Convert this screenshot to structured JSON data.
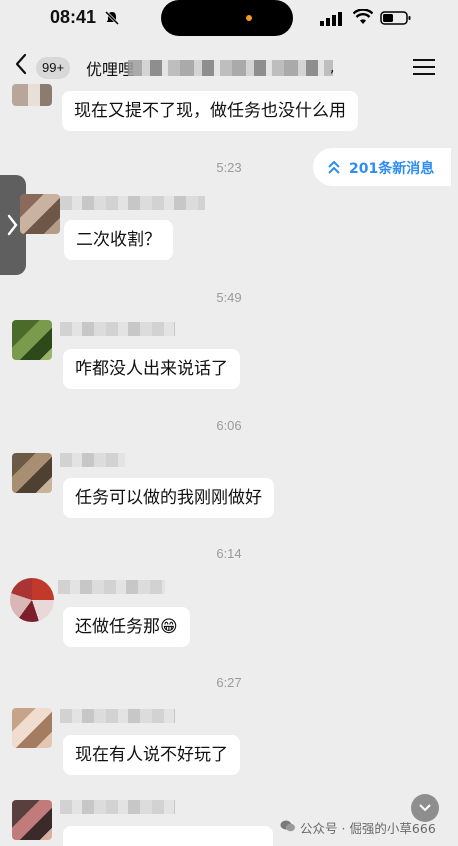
{
  "status_bar": {
    "time": "08:41"
  },
  "header": {
    "unread_count": "99+",
    "title_visible": "优哩哩",
    "title_tail": ","
  },
  "new_messages_pill": {
    "label": "201条新消息"
  },
  "timeline": [
    {
      "type": "message",
      "text": "现在又提不了现，做任务也没什么用"
    },
    {
      "type": "time",
      "text": "5:23"
    },
    {
      "type": "message",
      "text": "二次收割？"
    },
    {
      "type": "time",
      "text": "5:49"
    },
    {
      "type": "message",
      "text": "咋都没人出来说话了"
    },
    {
      "type": "time",
      "text": "6:06"
    },
    {
      "type": "message",
      "text": "任务可以做的我刚刚做好"
    },
    {
      "type": "time",
      "text": "6:14"
    },
    {
      "type": "message",
      "text": "还做任务那😁"
    },
    {
      "type": "time",
      "text": "6:27"
    },
    {
      "type": "message",
      "text": "现在有人说不好玩了"
    }
  ],
  "watermark": {
    "text": "公众号 · 倔强的小草666"
  },
  "colors": {
    "accent_blue": "#2f8df0",
    "background": "#ededed",
    "bubble": "#ffffff",
    "timestamp": "#9a9a9a"
  }
}
